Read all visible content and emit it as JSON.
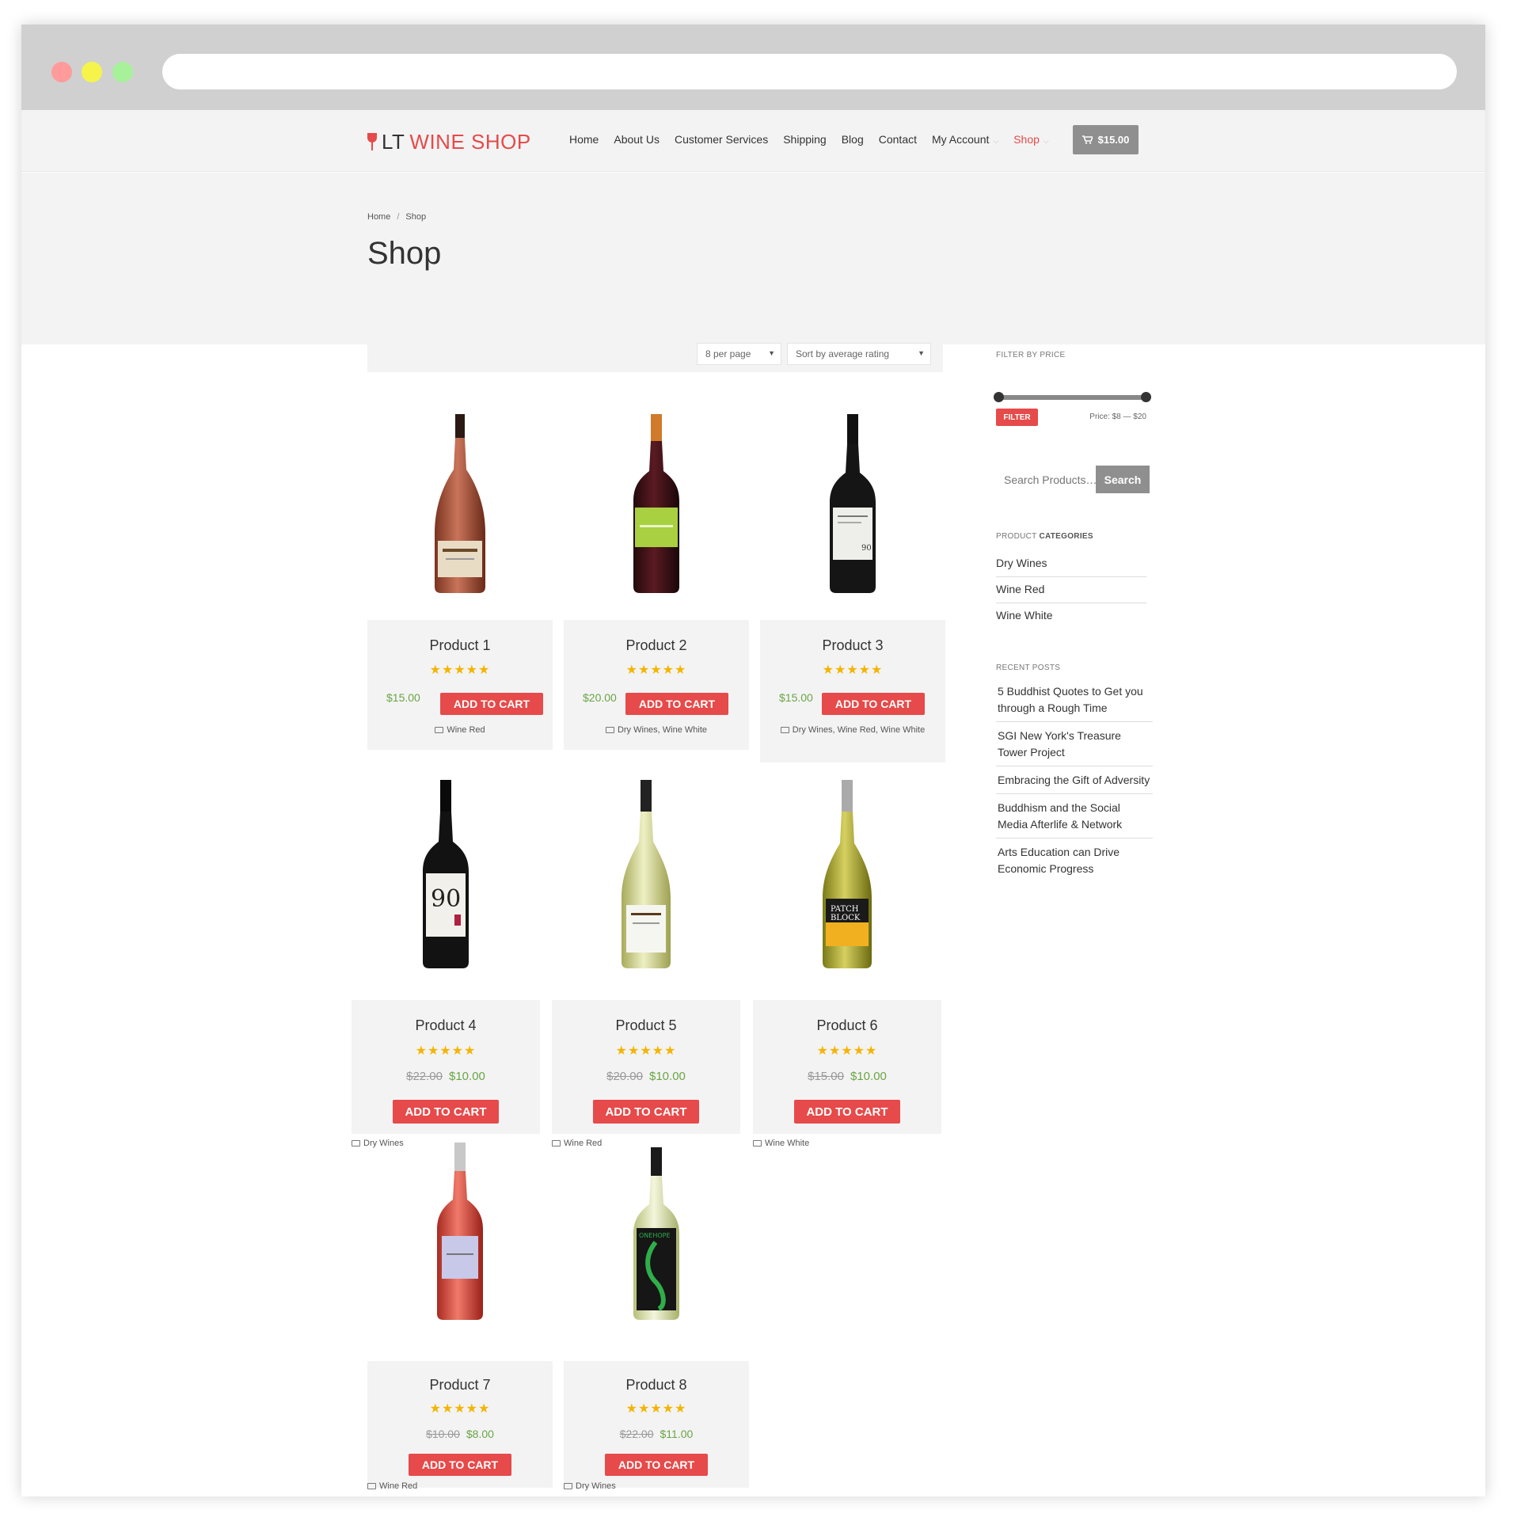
{
  "site": {
    "logo_prefix": "LT",
    "logo_name": "WINE SHOP",
    "nav": [
      {
        "label": "Home"
      },
      {
        "label": "About Us"
      },
      {
        "label": "Customer Services"
      },
      {
        "label": "Shipping"
      },
      {
        "label": "Blog"
      },
      {
        "label": "Contact"
      },
      {
        "label": "My Account"
      },
      {
        "label": "Shop"
      }
    ],
    "cart_total": "$15.00"
  },
  "page": {
    "breadcrumb": [
      "Home",
      "Shop"
    ],
    "breadcrumb_sep": "/",
    "title": "Shop"
  },
  "toolbar": {
    "per_page": "8 per page",
    "sort": "Sort by average rating"
  },
  "products": [
    {
      "name": "Product 1",
      "stars": "★★★★★",
      "rating": 5,
      "price": "$15.00",
      "old_price": "",
      "button": "ADD TO CART",
      "categories": "Wine Red"
    },
    {
      "name": "Product 2",
      "stars": "★★★★★",
      "rating": 5,
      "price": "$20.00",
      "old_price": "",
      "button": "ADD TO CART",
      "categories": "Dry Wines, Wine White"
    },
    {
      "name": "Product 3",
      "stars": "★★★★★",
      "rating": 5,
      "price": "$15.00",
      "old_price": "",
      "button": "ADD TO CART",
      "categories": "Dry Wines, Wine Red, Wine White"
    },
    {
      "name": "Product 4",
      "stars": "★★★★★",
      "rating": 5,
      "price": "$10.00",
      "old_price": "$22.00",
      "button": "ADD TO CART",
      "categories": "Dry Wines"
    },
    {
      "name": "Product 5",
      "stars": "★★★★★",
      "rating": 5,
      "price": "$10.00",
      "old_price": "$20.00",
      "button": "ADD TO CART",
      "categories": "Wine Red"
    },
    {
      "name": "Product 6",
      "stars": "★★★★★",
      "rating": 5,
      "price": "$10.00",
      "old_price": "$15.00",
      "button": "ADD TO CART",
      "categories": "Wine White"
    },
    {
      "name": "Product 7",
      "stars": "★★★★★",
      "rating": 5,
      "price": "$8.00",
      "old_price": "$10.00",
      "button": "ADD TO CART",
      "categories": "Wine Red"
    },
    {
      "name": "Product 8",
      "stars": "★★★★★",
      "rating": 5,
      "price": "$11.00",
      "old_price": "$22.00",
      "button": "ADD TO CART",
      "categories": "Dry Wines"
    }
  ],
  "sidebar": {
    "filter_title": "FILTER BY PRICE",
    "filter_button": "FILTER",
    "price_range": "Price: $8 — $20",
    "search_placeholder": "Search Products…",
    "search_button": "Search",
    "categories_title_1": "PRODUCT",
    "categories_title_2": "CATEGORIES",
    "categories": [
      "Dry Wines",
      "Wine Red",
      "Wine White"
    ],
    "posts_title": "RECENT POSTS",
    "posts": [
      "5 Buddhist Quotes to Get you through a Rough Time",
      "SGI New York's Treasure Tower Project",
      "Embracing the Gift of Adversity",
      "Buddhism and the Social Media Afterlife & Network",
      "Arts Education can Drive Economic Progress"
    ]
  },
  "colors": {
    "accent": "#e64a4a",
    "price_green": "#6aa544",
    "star": "#f4b400",
    "panel": "#f3f3f3"
  }
}
